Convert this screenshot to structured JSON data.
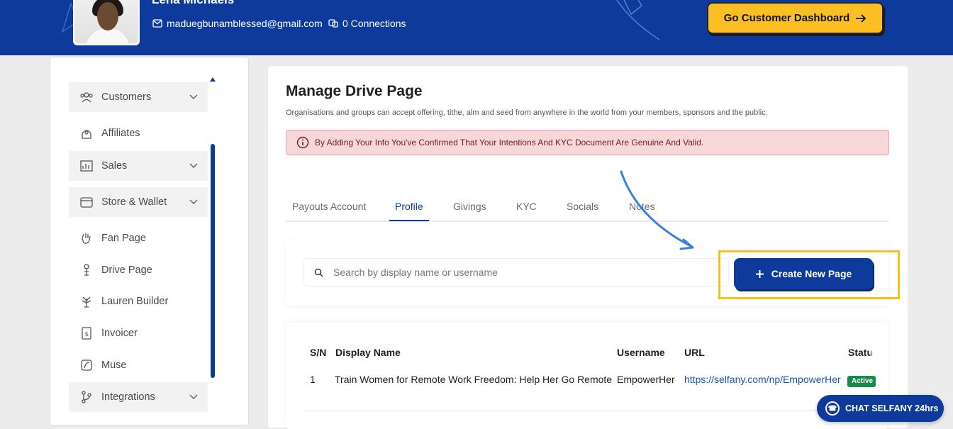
{
  "header": {
    "user_name": "Lena Michaels",
    "email": "maduegbunamblessed@gmail.com",
    "connections": "0 Connections",
    "dashboard_button": "Go Customer Dashboard"
  },
  "sidebar": {
    "items": [
      {
        "label": "Customers"
      },
      {
        "label": "Affiliates"
      },
      {
        "label": "Sales"
      },
      {
        "label": "Store & Wallet"
      },
      {
        "label": "Fan Page"
      },
      {
        "label": "Drive Page"
      },
      {
        "label": "Lauren Builder"
      },
      {
        "label": "Invoicer"
      },
      {
        "label": "Muse"
      },
      {
        "label": "Integrations"
      }
    ]
  },
  "main": {
    "title": "Manage Drive Page",
    "subtitle": "Organisations and groups can accept offering, tithe, alm and seed from anywhere in the world from your members, sponsors and the public.",
    "alert": "By Adding Your Info You've Confirmed That Your Intentions And KYC Document Are Genuine And Valid.",
    "tabs": [
      "Payouts Account",
      "Profile",
      "Givings",
      "KYC",
      "Socials",
      "Notes"
    ],
    "active_tab": "Profile",
    "search_placeholder": "Search by display name or username",
    "create_button": "Create New Page",
    "table": {
      "headers": [
        "S/N",
        "Display Name",
        "Username",
        "URL",
        "Status"
      ],
      "rows": [
        {
          "sn": "1",
          "display_name": "Train Women for Remote Work Freedom: Help Her Go Remote",
          "username": "EmpowerHer",
          "url": "https://selfany.com/np/EmpowerHer",
          "status": "Active"
        }
      ]
    }
  },
  "chat": {
    "label": "CHAT SELFANY 24hrs"
  },
  "colors": {
    "brand": "#0d3a9b",
    "accent": "#fbbf24",
    "alert_bg": "#f8d7da",
    "status_active": "#178a4a"
  }
}
